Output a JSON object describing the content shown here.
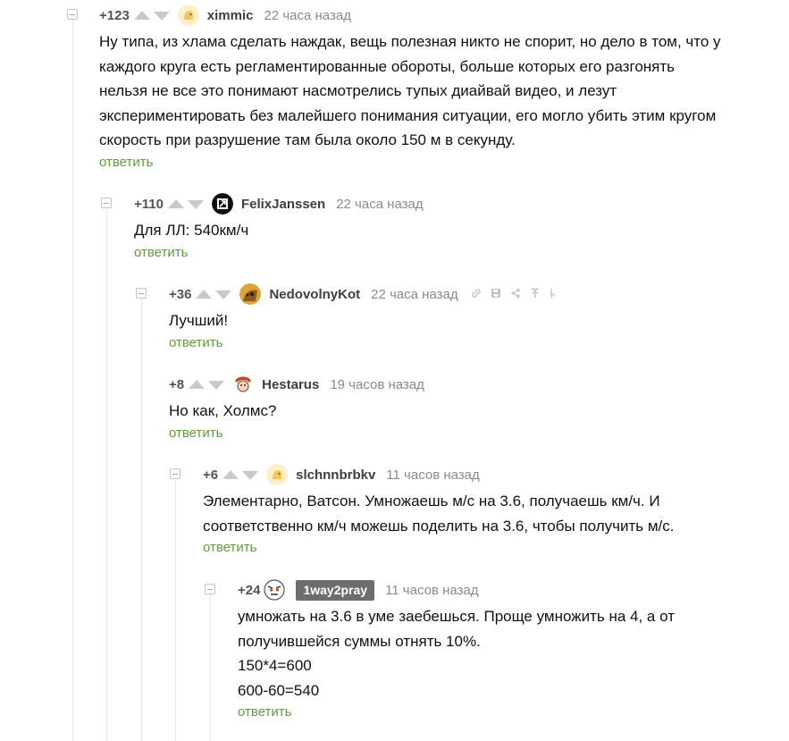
{
  "reply_label": "ответить",
  "colors": {
    "reply_link": "#5e9c3c",
    "rating": "#545454",
    "author": "#3e3e3e",
    "time": "#8a8a8a",
    "vote_arrow": "#c9c9c9",
    "thread_line": "#e6e6e6",
    "author_badge_bg": "#6d6d6d"
  },
  "comments": [
    {
      "rating": "+123",
      "author": "ximmic",
      "avatar_icon": "default-avatar-icon",
      "time": "22 часа назад",
      "lines": [
        "Ну типа, из хлама сделать наждак, вещь полезная никто не спорит, но дело в  том, что у",
        "каждого круга есть регламентированные обороты, больше которых его разгонять",
        "нельзя не все это понимают насмотрелись тупых диайвай видео, и лезут",
        "экспериментировать без малейшего понимания ситуации, его могло убить этим кругом",
        "скорость при разрушение там была около 150 м в секунду."
      ]
    },
    {
      "rating": "+110",
      "author": "FelixJanssen",
      "avatar_icon": "black-square-logo-avatar",
      "time": "22 часа назад",
      "lines": [
        "Для ЛЛ: 540км/ч"
      ]
    },
    {
      "rating": "+36",
      "author": "NedovolnyKot",
      "avatar_icon": "cat-avatar",
      "time": "22 часа назад",
      "tools": [
        "link-icon",
        "save-icon",
        "share-icon",
        "go-to-parent-icon",
        "more-icon"
      ],
      "lines": [
        "Лучший!"
      ]
    },
    {
      "rating": "+8",
      "author": "Hestarus",
      "avatar_icon": "cartoon-avatar",
      "time": "19 часов назад",
      "lines": [
        "Но как, Холмс?"
      ]
    },
    {
      "rating": "+6",
      "author": "slchnnbrbkv",
      "avatar_icon": "default-avatar-icon",
      "time": "11 часов назад",
      "lines": [
        "Элементарно, Ватсон. Умножаешь м/с на 3.6, получаешь км/ч. И",
        "соответственно км/ч можешь поделить на 3.6, чтобы получить м/с."
      ]
    },
    {
      "rating": "+24",
      "author": "1way2pray",
      "author_is_op": true,
      "avatar_icon": "angry-face-avatar",
      "time": "11 часов назад",
      "lines": [
        "умножать на 3.6 в уме заебешься. Проще умножить на 4, а от",
        "получившейся суммы отнять 10%.",
        "150*4=600",
        "600-60=540"
      ]
    }
  ]
}
